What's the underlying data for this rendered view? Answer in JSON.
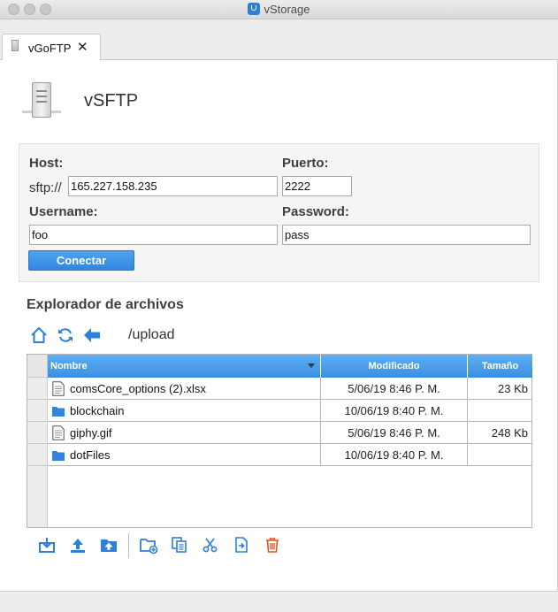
{
  "window": {
    "title": "vStorage"
  },
  "tab": {
    "label": "vGoFTP",
    "close_glyph": "✕"
  },
  "service": {
    "title": "vSFTP"
  },
  "form": {
    "host_label": "Host:",
    "protocol_prefix": "sftp://",
    "host_value": "165.227.158.235",
    "port_label": "Puerto:",
    "port_value": "2222",
    "username_label": "Username:",
    "username_value": "foo",
    "password_label": "Password:",
    "password_value": "pass",
    "connect_label": "Conectar"
  },
  "explorer": {
    "title": "Explorador de archivos",
    "current_path": "/upload",
    "nav_icons": [
      "home-icon",
      "refresh-icon",
      "back-arrow-icon"
    ],
    "columns": [
      "Nombre",
      "Modificado",
      "Tamaño"
    ],
    "rows": [
      {
        "type": "file",
        "name": "comsCore_options (2).xlsx",
        "modified": "5/06/19 8:46 P. M.",
        "size": "23 Kb"
      },
      {
        "type": "folder",
        "name": "blockchain",
        "modified": "10/06/19 8:40 P. M.",
        "size": ""
      },
      {
        "type": "file",
        "name": "giphy.gif",
        "modified": "5/06/19 8:46 P. M.",
        "size": "248 Kb"
      },
      {
        "type": "folder",
        "name": "dotFiles",
        "modified": "10/06/19 8:40 P. M.",
        "size": ""
      }
    ]
  },
  "toolbar": {
    "icons": [
      "download-icon",
      "upload-icon",
      "upload-folder-icon",
      "new-folder-icon",
      "copy-icon",
      "cut-icon",
      "move-icon",
      "delete-icon"
    ]
  },
  "colors": {
    "accent": "#3b8fe0",
    "folder": "#2f86de",
    "delete": "#e0531f"
  }
}
